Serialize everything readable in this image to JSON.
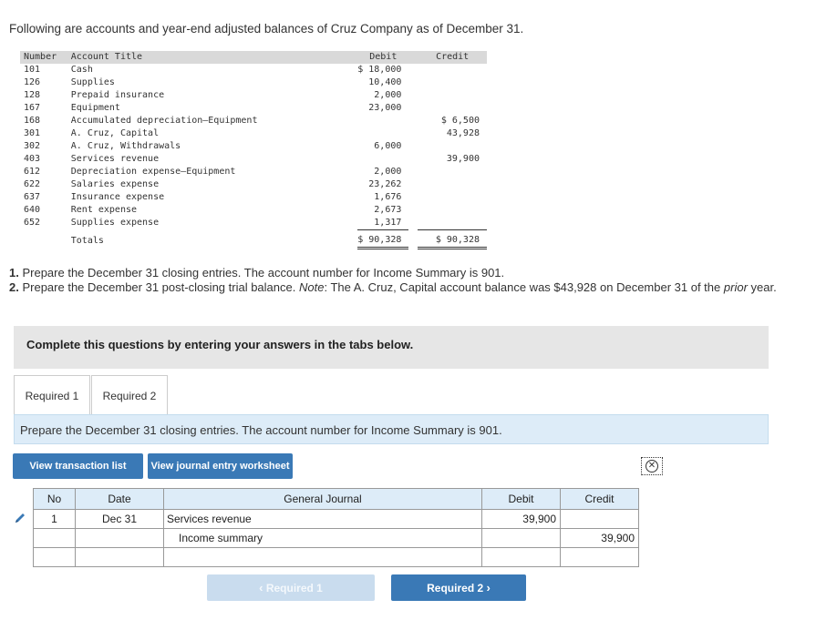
{
  "intro": "Following are accounts and year-end adjusted balances of Cruz Company as of December 31.",
  "accounts": {
    "headers": {
      "number": "Number",
      "title": "Account Title",
      "debit": "Debit",
      "credit": "Credit"
    },
    "rows": [
      {
        "number": "101",
        "title": "Cash",
        "debit": "$ 18,000",
        "credit": ""
      },
      {
        "number": "126",
        "title": "Supplies",
        "debit": "10,400",
        "credit": ""
      },
      {
        "number": "128",
        "title": "Prepaid insurance",
        "debit": "2,000",
        "credit": ""
      },
      {
        "number": "167",
        "title": "Equipment",
        "debit": "23,000",
        "credit": ""
      },
      {
        "number": "168",
        "title": "Accumulated depreciation—Equipment",
        "debit": "",
        "credit": "$ 6,500"
      },
      {
        "number": "301",
        "title": "A. Cruz, Capital",
        "debit": "",
        "credit": "43,928"
      },
      {
        "number": "302",
        "title": "A. Cruz, Withdrawals",
        "debit": "6,000",
        "credit": ""
      },
      {
        "number": "403",
        "title": "Services revenue",
        "debit": "",
        "credit": "39,900"
      },
      {
        "number": "612",
        "title": "Depreciation expense—Equipment",
        "debit": "2,000",
        "credit": ""
      },
      {
        "number": "622",
        "title": "Salaries expense",
        "debit": "23,262",
        "credit": ""
      },
      {
        "number": "637",
        "title": "Insurance expense",
        "debit": "1,676",
        "credit": ""
      },
      {
        "number": "640",
        "title": "Rent expense",
        "debit": "2,673",
        "credit": ""
      },
      {
        "number": "652",
        "title": "Supplies expense",
        "debit": "1,317",
        "credit": ""
      }
    ],
    "totals": {
      "label": "Totals",
      "debit": "$ 90,328",
      "credit": "$ 90,328"
    }
  },
  "instructions": {
    "item1_num": "1.",
    "item1": "Prepare the December 31 closing entries. The account number for Income Summary is 901.",
    "item2_num": "2.",
    "item2_a": "Prepare the December 31 post-closing trial balance.",
    "item2_note": "Note",
    "item2_b": ": The A. Cruz, Capital account balance was $43,928 on December 31 of the",
    "item2_prior": "prior",
    "item2_c": "year."
  },
  "complete_box": "Complete this questions by entering your answers in the tabs below.",
  "tabs": [
    "Required 1",
    "Required 2"
  ],
  "prep_text": "Prepare the December 31 closing entries. The account number for Income Summary is 901.",
  "buttons": {
    "view_transactions": "View transaction list",
    "view_journal": "View journal entry worksheet",
    "prev": "Required 1",
    "next": "Required 2"
  },
  "journal": {
    "headers": {
      "no": "No",
      "date": "Date",
      "gj": "General Journal",
      "debit": "Debit",
      "credit": "Credit"
    },
    "rows": [
      {
        "no": "1",
        "date": "Dec 31",
        "account": "Services revenue",
        "debit": "39,900",
        "credit": "",
        "indent": false
      },
      {
        "no": "",
        "date": "",
        "account": "Income summary",
        "debit": "",
        "credit": "39,900",
        "indent": true
      },
      {
        "no": "",
        "date": "",
        "account": "",
        "debit": "",
        "credit": "",
        "indent": false
      }
    ]
  },
  "icons": {
    "close": "close-circle-icon",
    "pencil": "pencil-icon",
    "chevron_left": "‹",
    "chevron_right": "›"
  },
  "colors": {
    "accent": "#3a79b6",
    "tab_panel": "#ddecf8",
    "disabled": "#c9dcee"
  }
}
